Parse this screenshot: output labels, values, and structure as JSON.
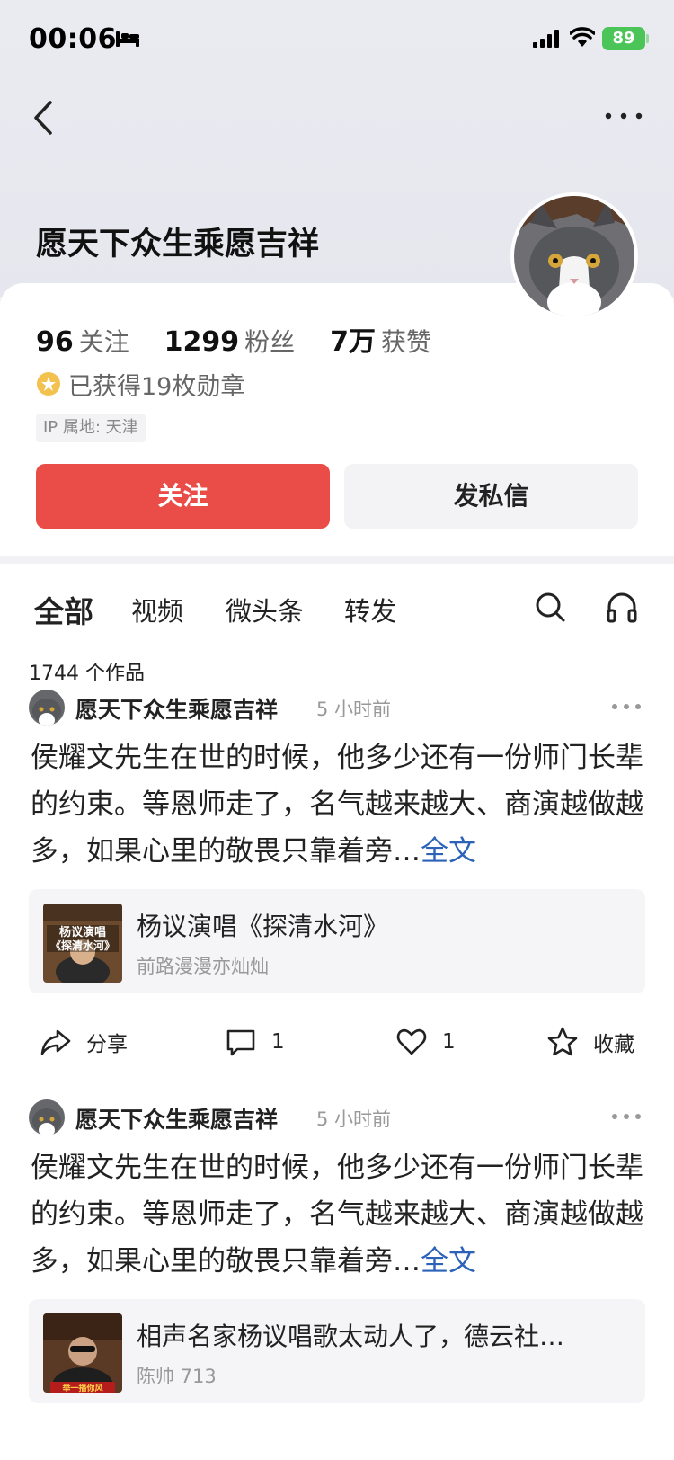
{
  "status_bar": {
    "time": "00:06",
    "battery": "89"
  },
  "profile": {
    "name": "愿天下众生乘愿吉祥",
    "following_count": "96",
    "following_label": "关注",
    "fans_count": "1299",
    "fans_label": "粉丝",
    "likes_count": "7万",
    "likes_label": "获赞",
    "medals": "已获得19枚勋章",
    "ip": "IP 属地: 天津",
    "follow_button": "关注",
    "message_button": "发私信"
  },
  "tabs": [
    "全部",
    "视频",
    "微头条",
    "转发"
  ],
  "works_count": "1744 个作品",
  "posts": [
    {
      "author": "愿天下众生乘愿吉祥",
      "time": "5 小时前",
      "text": "侯耀文先生在世的时候，他多少还有一份师门长辈的约束。等恩师走了，名气越来越大、商演越做越多，如果心里的敬畏只靠着旁…",
      "more_link": "全文",
      "attachment": {
        "title": "杨议演唱《探清水河》",
        "subtitle": "前路漫漫亦灿灿",
        "thumb_text": "杨议演唱\n《探清水河》"
      },
      "share_label": "分享",
      "comments": "1",
      "likes": "1",
      "favorite_label": "收藏"
    },
    {
      "author": "愿天下众生乘愿吉祥",
      "time": "5 小时前",
      "text": "侯耀文先生在世的时候，他多少还有一份师门长辈的约束。等恩师走了，名气越来越大、商演越做越多，如果心里的敬畏只靠着旁…",
      "more_link": "全文",
      "attachment": {
        "title": "相声名家杨议唱歌太动人了，德云社…",
        "subtitle": "陈帅 713",
        "thumb_text": "举一播你风"
      }
    }
  ],
  "colors": {
    "accent": "#ea4d48",
    "link": "#2c63b8",
    "battery": "#4bc557"
  }
}
